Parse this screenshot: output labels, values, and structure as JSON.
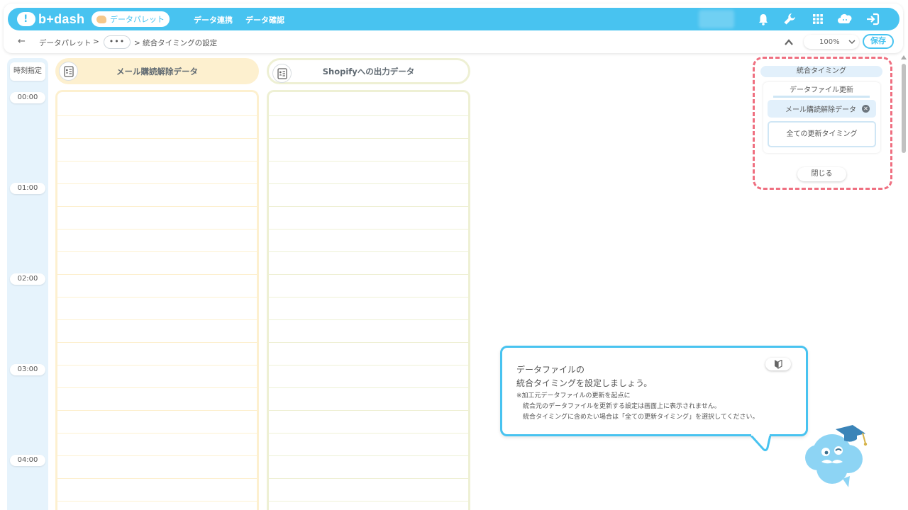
{
  "header": {
    "logo_text": "b+dash",
    "active_nav": "データパレット",
    "nav_links": [
      "データ連携",
      "データ確認"
    ]
  },
  "breadcrumb": {
    "back_arrow": "←",
    "items": [
      "データパレット",
      ">",
      "•••",
      "> 統合タイミングの設定"
    ]
  },
  "toolbar": {
    "zoom": "100%",
    "save_label": "保存"
  },
  "timeline": {
    "header": "時刻指定",
    "times": [
      "00:00",
      "01:00",
      "02:00",
      "03:00",
      "04:00"
    ]
  },
  "columns": [
    {
      "title": "メール購読解除データ",
      "head_bg": "#fdf0cf",
      "border": "#fdf0cf"
    },
    {
      "title": "Shopifyへの出力データ",
      "head_bg": "#ffffff",
      "border": "#eef0d4"
    }
  ],
  "panel": {
    "title": "統合タイミング",
    "subtitle": "データファイル更新",
    "chip": "メール購読解除データ",
    "all_option": "全ての更新タイミング",
    "close_label": "閉じる"
  },
  "guide": {
    "line1": "データファイルの",
    "line2": "統合タイミングを設定しましょう。",
    "note1": "※加工元データファイルの更新を起点に",
    "note2": "統合元のデータファイルを更新する設定は画面上に表示されません。",
    "note3": "統合タイミングに含めたい場合は「全ての更新タイミング」を選択してください。"
  },
  "colors": {
    "accent": "#48c3f0",
    "panel_border": "#ef6f80"
  }
}
